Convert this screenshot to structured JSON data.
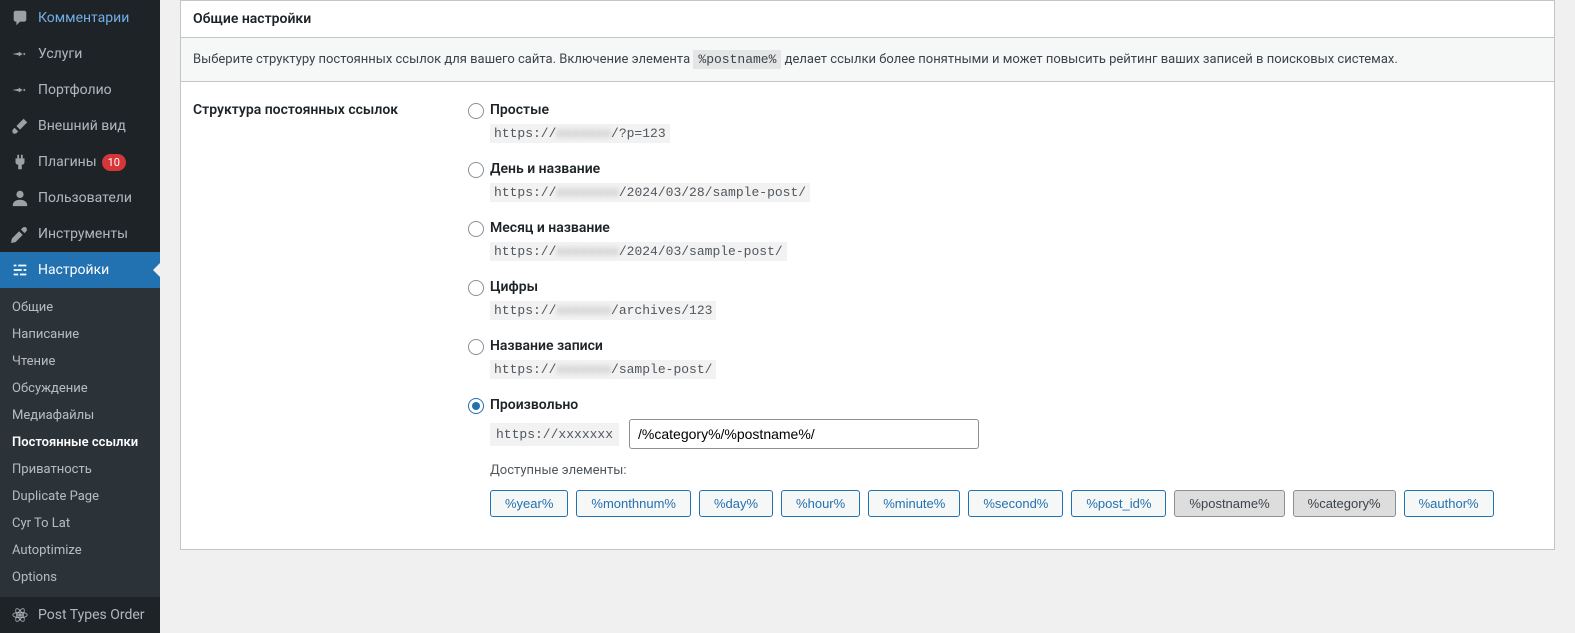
{
  "sidebar": {
    "main": [
      {
        "id": "comments",
        "label": "Комментарии",
        "icon": "comment"
      },
      {
        "id": "services",
        "label": "Услуги",
        "icon": "pin"
      },
      {
        "id": "portfolio",
        "label": "Портфолио",
        "icon": "pin"
      },
      {
        "id": "appearance",
        "label": "Внешний вид",
        "icon": "brush"
      },
      {
        "id": "plugins",
        "label": "Плагины",
        "icon": "plug",
        "badge": "10"
      },
      {
        "id": "users",
        "label": "Пользователи",
        "icon": "user"
      },
      {
        "id": "tools",
        "label": "Инструменты",
        "icon": "wrench"
      },
      {
        "id": "settings",
        "label": "Настройки",
        "icon": "sliders",
        "current": true
      }
    ],
    "submenu": [
      {
        "id": "general",
        "label": "Общие"
      },
      {
        "id": "writing",
        "label": "Написание"
      },
      {
        "id": "reading",
        "label": "Чтение"
      },
      {
        "id": "discussion",
        "label": "Обсуждение"
      },
      {
        "id": "media",
        "label": "Медиафайлы"
      },
      {
        "id": "permalinks",
        "label": "Постоянные ссылки",
        "current": true
      },
      {
        "id": "privacy",
        "label": "Приватность"
      },
      {
        "id": "duplicate",
        "label": "Duplicate Page"
      },
      {
        "id": "cyrtolat",
        "label": "Cyr To Lat"
      },
      {
        "id": "autoptimize",
        "label": "Autoptimize"
      },
      {
        "id": "options",
        "label": "Options"
      }
    ],
    "extra": [
      {
        "id": "pto",
        "label": "Post Types Order",
        "icon": "atom"
      }
    ]
  },
  "panel": {
    "header": "Общие настройки",
    "desc_before": "Выберите структуру постоянных ссылок для вашего сайта. Включение элемента ",
    "desc_code": "%postname%",
    "desc_after": " делает ссылки более понятными и может повысить рейтинг ваших записей в поисковых системах."
  },
  "form": {
    "section_label": "Структура постоянных ссылок",
    "options": [
      {
        "id": "plain",
        "label": "Простые",
        "url_prefix": "https://",
        "domain": "xxxxxxx",
        "url_suffix": "/?p=123"
      },
      {
        "id": "dayname",
        "label": "День и название",
        "url_prefix": "https://",
        "domain": "xxxxxxxx",
        "url_suffix": "/2024/03/28/sample-post/"
      },
      {
        "id": "monthname",
        "label": "Месяц и название",
        "url_prefix": "https://",
        "domain": "xxxxxxxx",
        "url_suffix": "/2024/03/sample-post/"
      },
      {
        "id": "numeric",
        "label": "Цифры",
        "url_prefix": "https://",
        "domain": "xxxxxxx",
        "url_suffix": "/archives/123"
      },
      {
        "id": "postname",
        "label": "Название записи",
        "url_prefix": "https://",
        "domain": "xxxxxxx",
        "url_suffix": "/sample-post/"
      },
      {
        "id": "custom",
        "label": "Произвольно",
        "url_prefix": "https://",
        "domain": "xxxxxxx",
        "checked": true
      }
    ],
    "custom_value": "/%category%/%postname%/",
    "available_label": "Доступные элементы:",
    "tokens": [
      {
        "label": "%year%",
        "active": false
      },
      {
        "label": "%monthnum%",
        "active": false
      },
      {
        "label": "%day%",
        "active": false
      },
      {
        "label": "%hour%",
        "active": false
      },
      {
        "label": "%minute%",
        "active": false
      },
      {
        "label": "%second%",
        "active": false
      },
      {
        "label": "%post_id%",
        "active": false
      },
      {
        "label": "%postname%",
        "active": true
      },
      {
        "label": "%category%",
        "active": true
      },
      {
        "label": "%author%",
        "active": false
      }
    ]
  }
}
